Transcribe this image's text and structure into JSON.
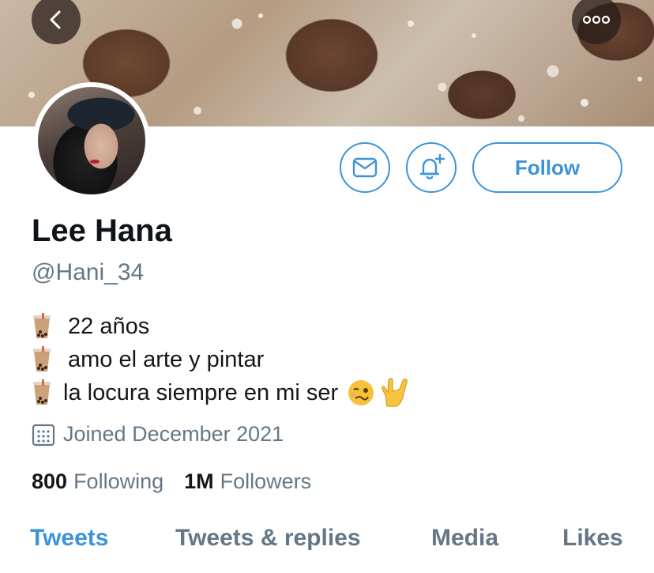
{
  "profile": {
    "name": "Lee Hana",
    "handle": "@Hani_34",
    "bio": [
      {
        "emoji": "bubble-tea",
        "text": "22 años"
      },
      {
        "emoji": "bubble-tea",
        "text": "amo el arte y pintar"
      },
      {
        "emoji": "bubble-tea",
        "text": "la locura siempre en mi ser"
      }
    ],
    "joined": "Joined December 2021",
    "following_count": "800",
    "following_label": "Following",
    "followers_count": "1M",
    "followers_label": "Followers"
  },
  "actions": {
    "follow_label": "Follow"
  },
  "tabs": [
    {
      "label": "Tweets",
      "active": true
    },
    {
      "label": "Tweets & replies",
      "active": false
    },
    {
      "label": "Media",
      "active": false
    },
    {
      "label": "Likes",
      "active": false
    }
  ],
  "colors": {
    "accent": "#3d93d9",
    "secondary_text": "#657786"
  },
  "icons": {
    "back": "chevron-left-icon",
    "more": "more-horizontal-icon",
    "message": "envelope-icon",
    "notify": "bell-plus-icon",
    "joined": "calendar-icon"
  }
}
